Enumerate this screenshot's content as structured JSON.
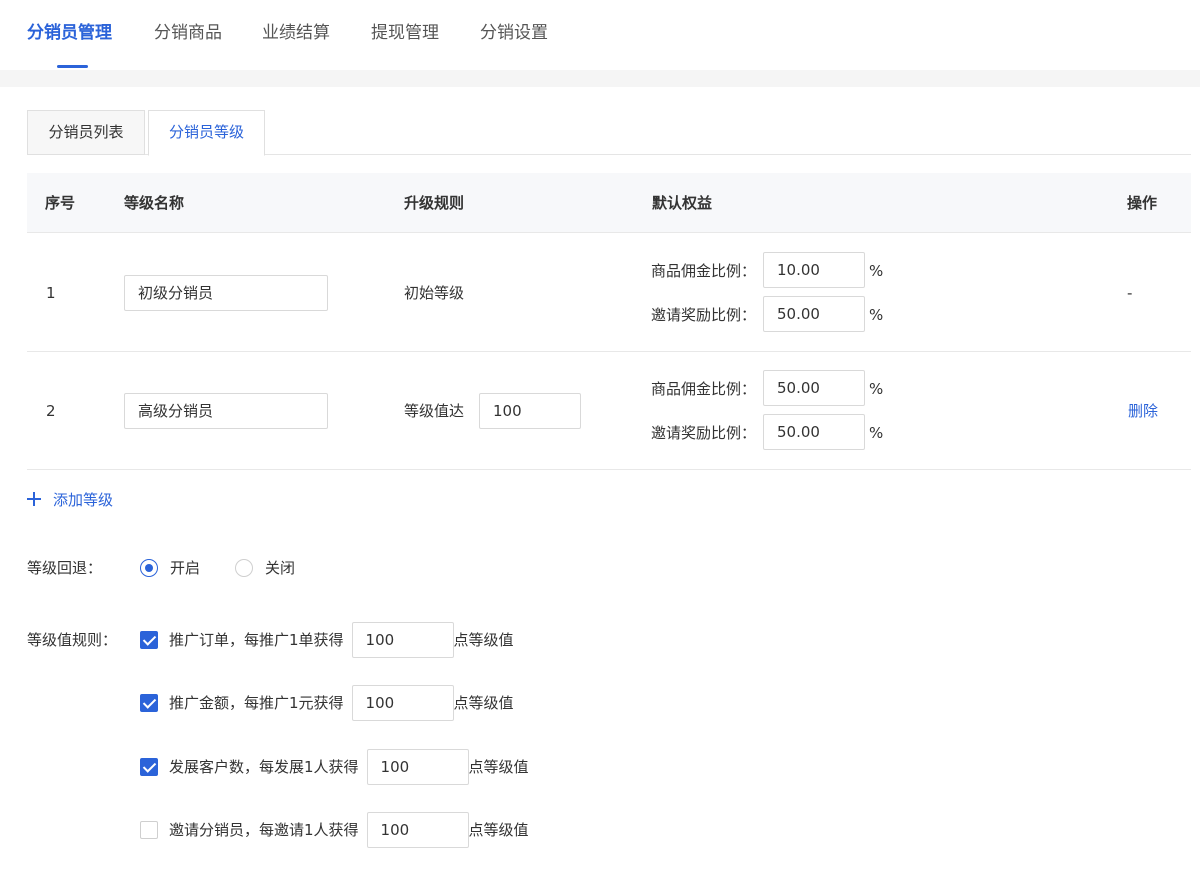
{
  "top_nav": {
    "tabs": [
      "分销员管理",
      "分销商品",
      "业绩结算",
      "提现管理",
      "分销设置"
    ],
    "active_index": 0
  },
  "sub_tabs": {
    "tabs": [
      "分销员列表",
      "分销员等级"
    ],
    "active_index": 1
  },
  "table": {
    "headers": {
      "index": "序号",
      "name": "等级名称",
      "rule": "升级规则",
      "rights": "默认权益",
      "action": "操作"
    },
    "commission_label": "商品佣金比例：",
    "invite_label": "邀请奖励比例：",
    "percent": "%",
    "rows": [
      {
        "index": "1",
        "name": "初级分销员",
        "rule_text": "初始等级",
        "rule_value": "",
        "commission": "10.00",
        "invite": "50.00",
        "action": "-"
      },
      {
        "index": "2",
        "name": "高级分销员",
        "rule_text": "等级值达",
        "rule_value": "100",
        "commission": "50.00",
        "invite": "50.00",
        "action": "删除"
      }
    ]
  },
  "add_level": {
    "label": "添加等级",
    "icon": "plus-icon"
  },
  "level_fallback": {
    "label": "等级回退：",
    "options": [
      "开启",
      "关闭"
    ],
    "selected_index": 0
  },
  "level_rules": {
    "label": "等级值规则：",
    "suffix": "点等级值",
    "items": [
      {
        "text": "推广订单，每推广1单获得",
        "value": "100",
        "checked": true
      },
      {
        "text": "推广金额，每推广1元获得",
        "value": "100",
        "checked": true
      },
      {
        "text": "发展客户数，每发展1人获得",
        "value": "100",
        "checked": true
      },
      {
        "text": "邀请分销员，每邀请1人获得",
        "value": "100",
        "checked": false
      }
    ]
  },
  "colors": {
    "accent": "#2b63d9",
    "header_bg": "#f7f8fa",
    "band_bg": "#f5f5f5"
  }
}
